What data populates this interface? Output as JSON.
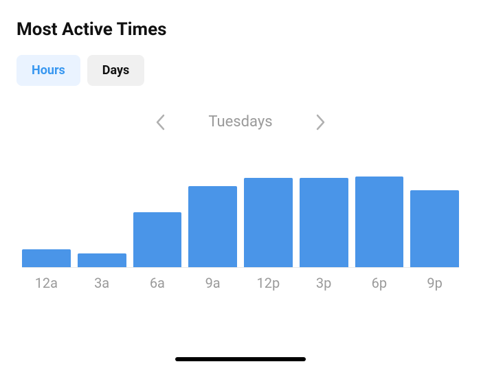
{
  "title": "Most Active Times",
  "tabs": {
    "hours": "Hours",
    "days": "Days"
  },
  "nav": {
    "label": "Tuesdays"
  },
  "chart_data": {
    "type": "bar",
    "title": "Most Active Times",
    "xlabel": "",
    "ylabel": "",
    "ylim": [
      0,
      150
    ],
    "categories": [
      "12a",
      "3a",
      "6a",
      "9a",
      "12p",
      "3p",
      "6p",
      "9p"
    ],
    "values": [
      26,
      20,
      80,
      118,
      130,
      130,
      132,
      112
    ]
  }
}
